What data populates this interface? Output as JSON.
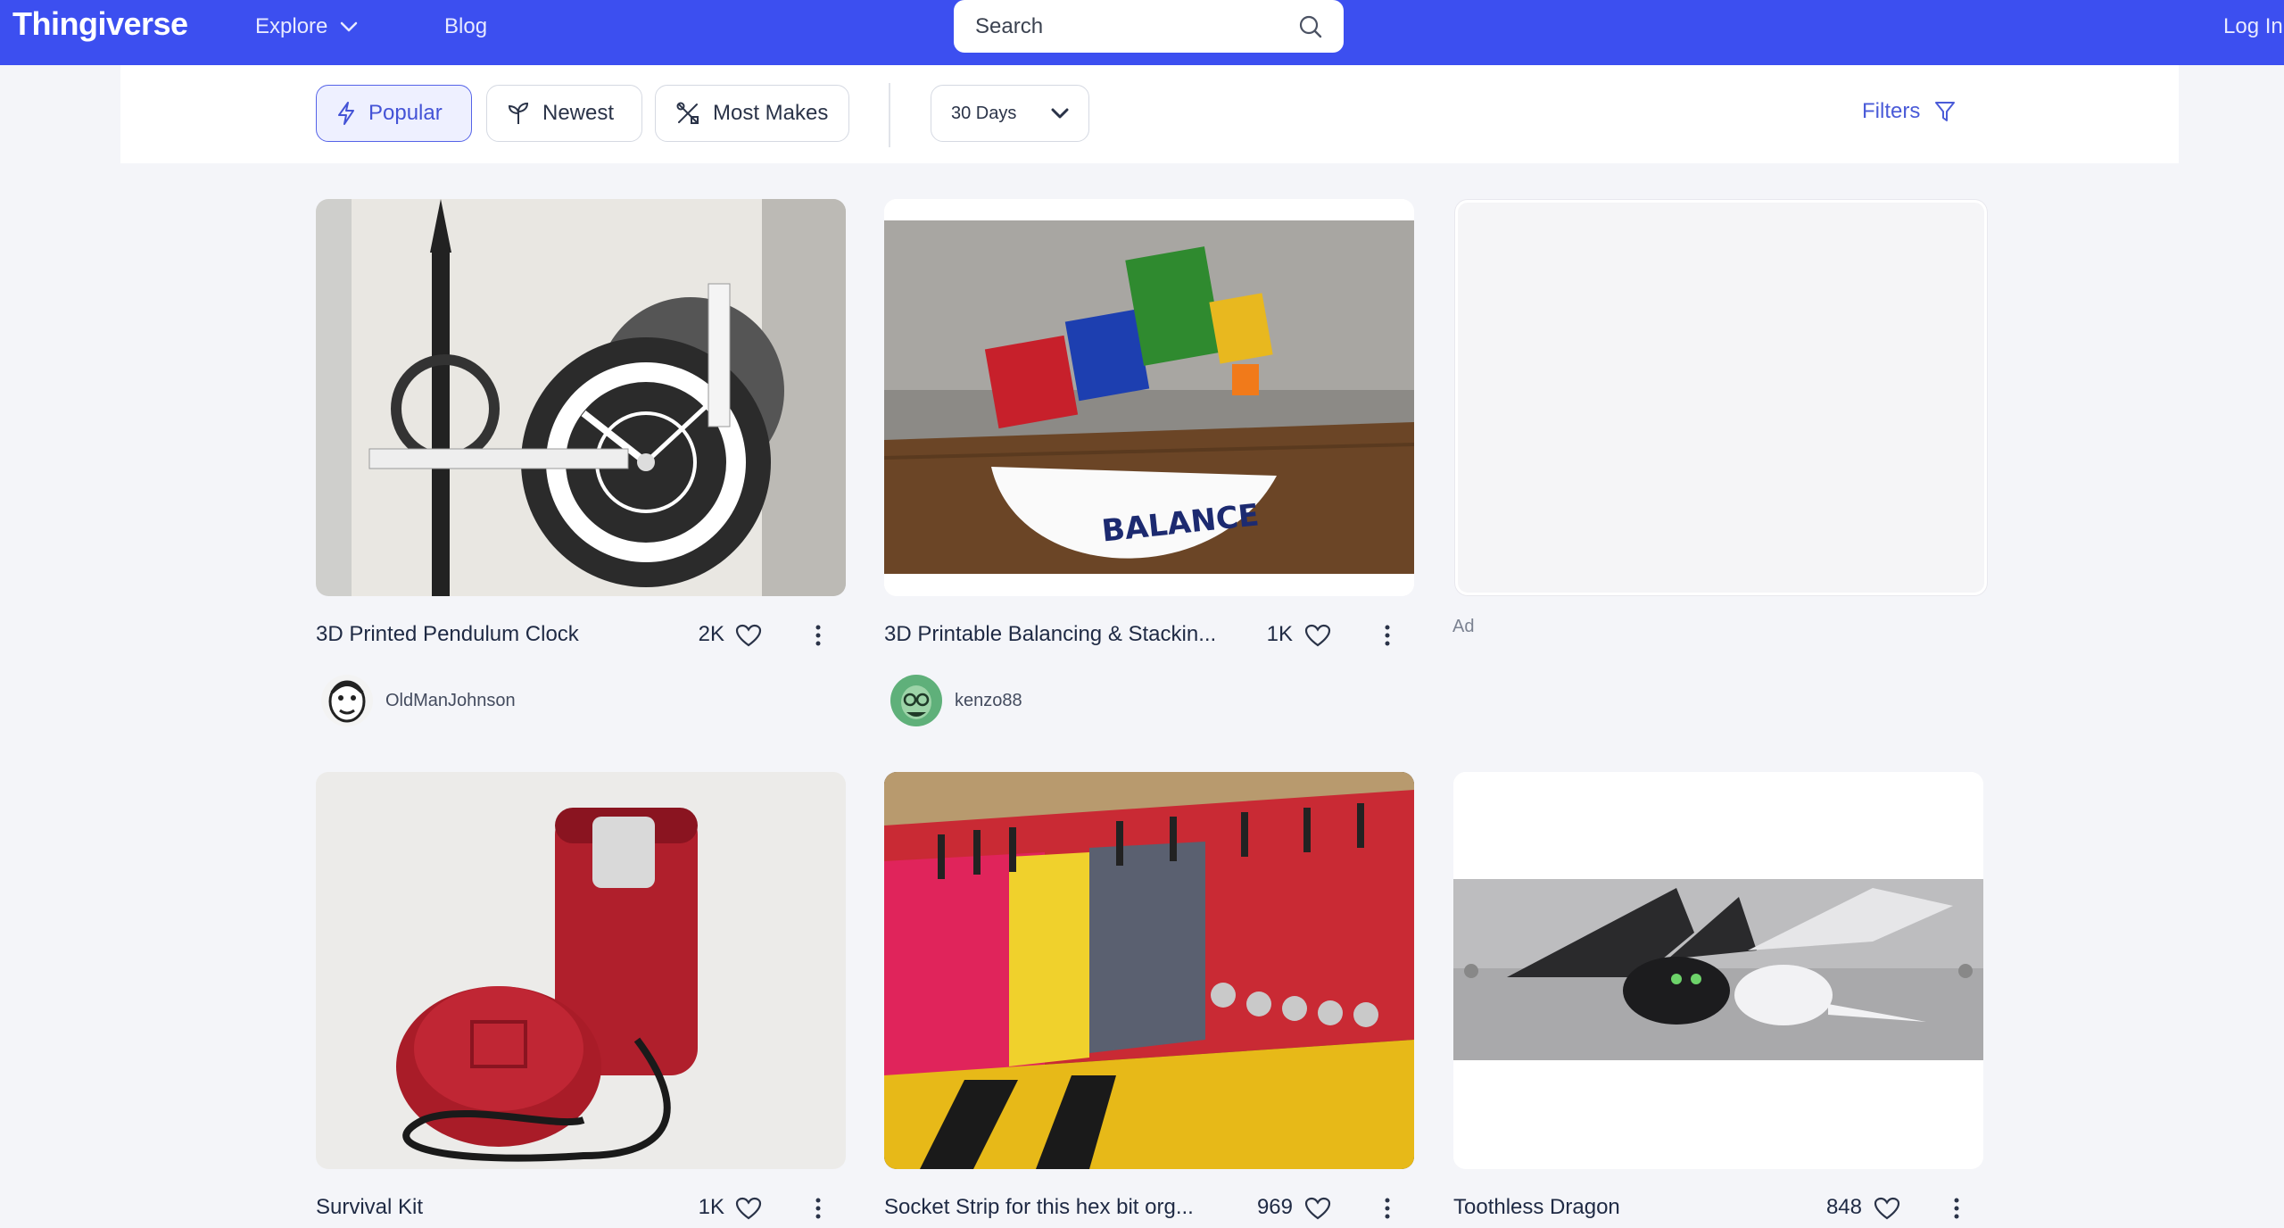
{
  "header": {
    "logo": "Thingiverse",
    "nav": {
      "explore": "Explore",
      "blog": "Blog"
    },
    "search_placeholder": "Search",
    "login": "Log In"
  },
  "filterbar": {
    "popular": "Popular",
    "newest": "Newest",
    "most_makes": "Most Makes",
    "period": "30 Days",
    "filters": "Filters",
    "active": "Popular"
  },
  "cards": [
    {
      "title": "3D Printed Pendulum Clock",
      "likes": "2K",
      "author": "OldManJohnson"
    },
    {
      "title": "3D Printable Balancing & Stackin...",
      "likes": "1K",
      "author": "kenzo88"
    },
    {
      "title": "Survival Kit",
      "likes": "1K"
    },
    {
      "title": "Socket Strip for this hex bit org...",
      "likes": "969"
    },
    {
      "title": "Toothless Dragon",
      "likes": "848"
    }
  ],
  "ad": {
    "label": "Ad"
  },
  "colors": {
    "header_bg": "#3c4ff0",
    "accent": "#4a5bd8",
    "page_bg": "#f4f5f9"
  }
}
